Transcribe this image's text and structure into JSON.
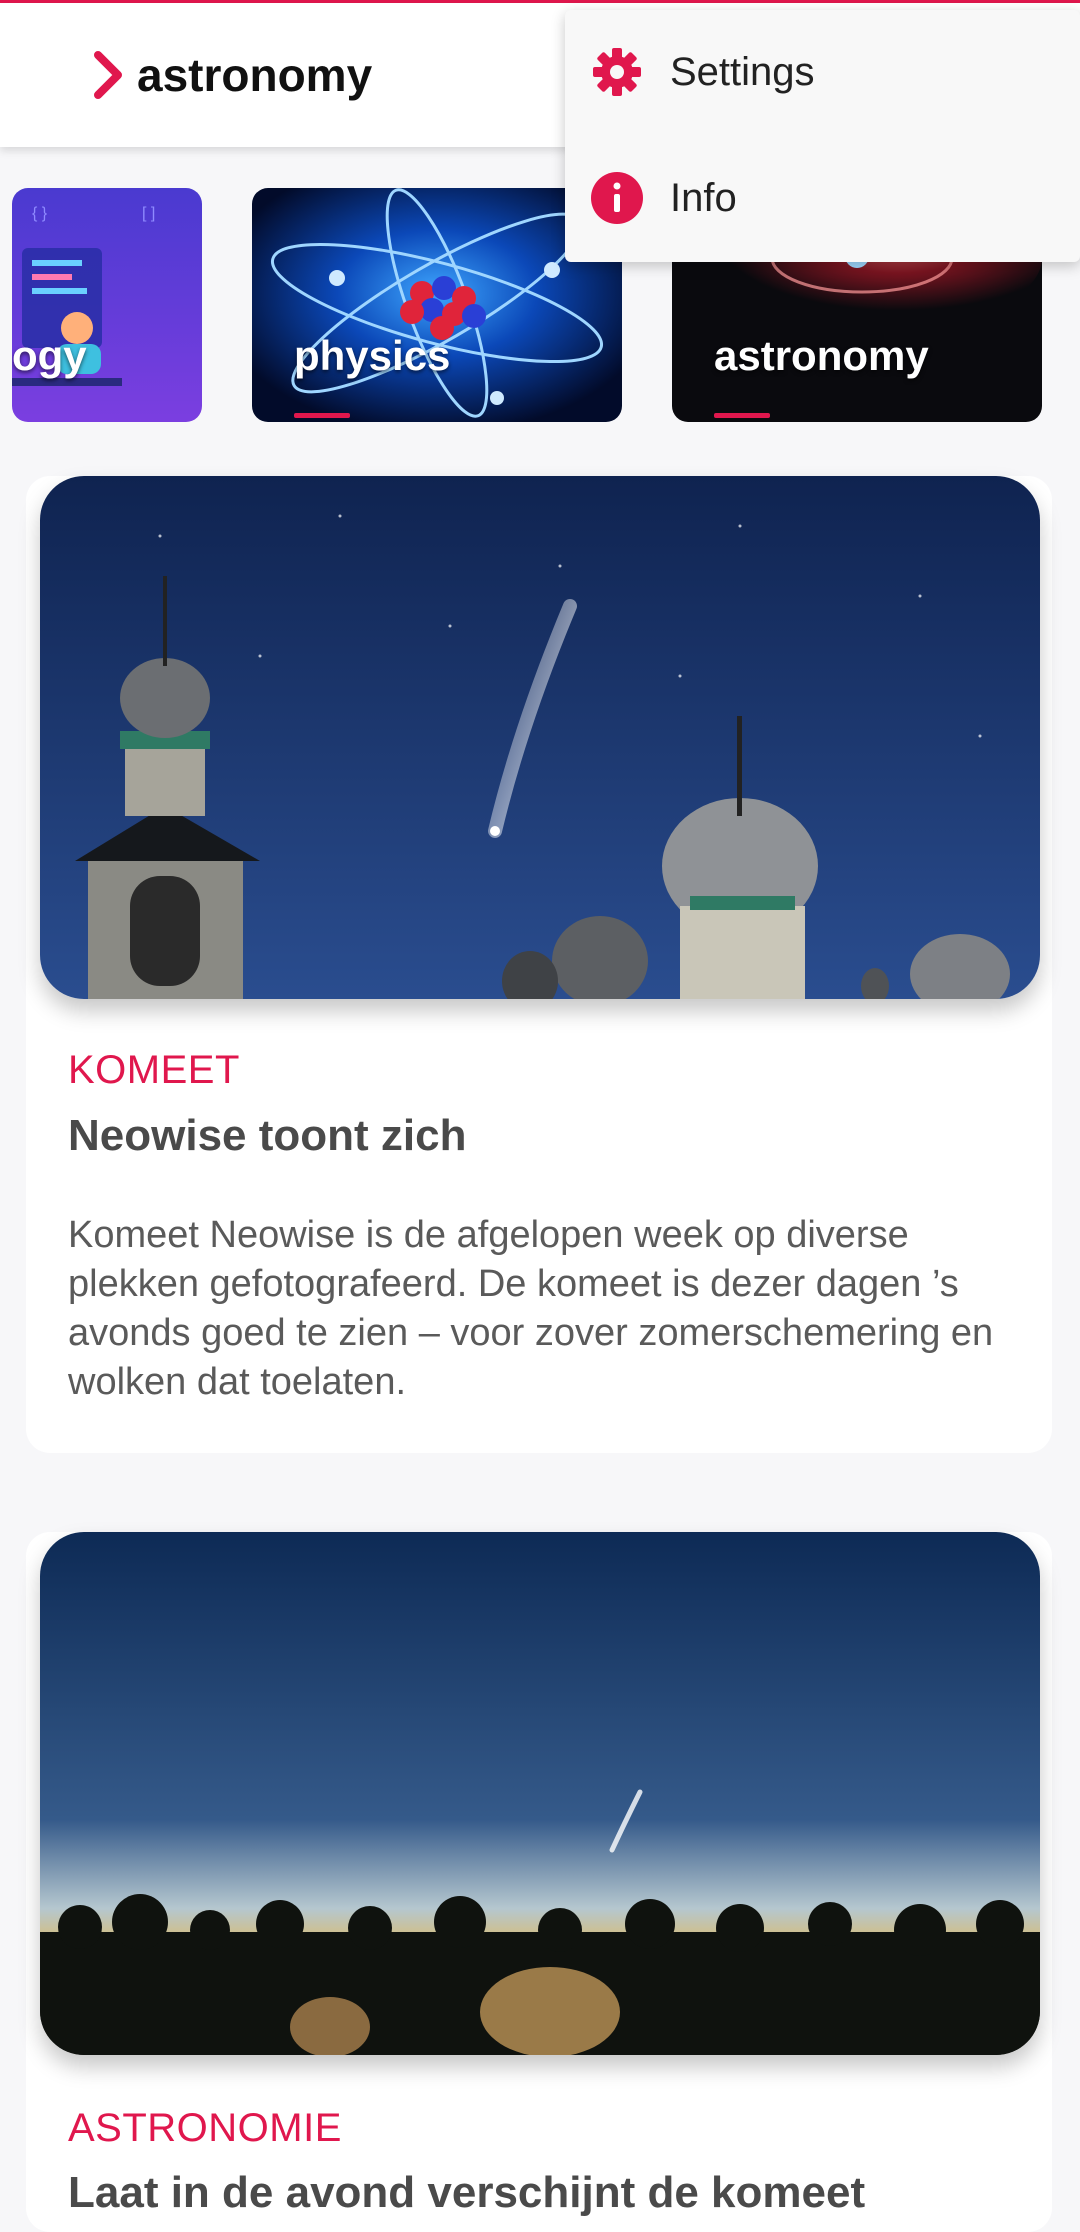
{
  "header": {
    "title": "astronomy",
    "chevron_icon": "chevron-right-icon",
    "accent_color": "#e0174d"
  },
  "categories": [
    {
      "label": "ogy",
      "active": false
    },
    {
      "label": "physics",
      "active": false
    },
    {
      "label": "astronomy",
      "active": true
    }
  ],
  "menu": {
    "items": [
      {
        "label": "Settings",
        "icon": "gear-icon"
      },
      {
        "label": "Info",
        "icon": "info-icon"
      }
    ]
  },
  "articles": [
    {
      "category": "KOMEET",
      "title": "Neowise toont zich",
      "summary": "Komeet Neowise is de afgelopen week op diverse plekken gefotografeerd. De komeet is dezer dagen ’s avonds goed te zien – voor zover zomerschemering en wolken dat toelaten."
    },
    {
      "category": "ASTRONOMIE",
      "title": "Laat in de avond verschijnt de komeet"
    }
  ]
}
